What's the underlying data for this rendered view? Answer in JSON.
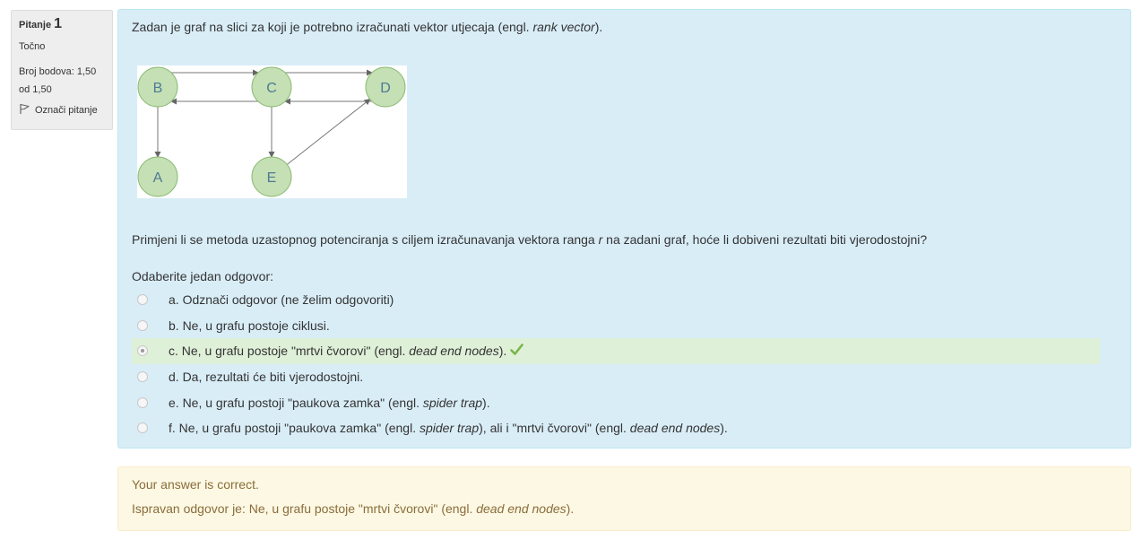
{
  "info": {
    "question_word": "Pitanje",
    "question_number": "1",
    "state": "Točno",
    "grade_line1": "Broj bodova: 1,50",
    "grade_line2": "od 1,50",
    "flag_label": "Označi pitanje",
    "flag_icon": "flag-icon"
  },
  "question": {
    "text_before": "Zadan je graf na slici za koji je potrebno izračunati vektor utjecaja (engl. ",
    "text_italic": "rank vector",
    "text_after": ").",
    "graph": {
      "nodes": [
        "B",
        "C",
        "D",
        "A",
        "E"
      ],
      "edges": [
        [
          "B",
          "C"
        ],
        [
          "C",
          "D"
        ],
        [
          "D",
          "C"
        ],
        [
          "C",
          "B"
        ],
        [
          "B",
          "A"
        ],
        [
          "C",
          "E"
        ],
        [
          "E",
          "D"
        ]
      ],
      "node_fill": "#c5e0b4",
      "node_stroke": "#8bbb74",
      "label_color": "#4d7a96"
    },
    "text2_before": "Primjeni li se metoda uzastopnog potenciranja s ciljem izračunavanja vektora ranga ",
    "text2_italic": "r",
    "text2_after": " na zadani graf, hoće li dobiveni rezultati biti vjerodostojni?",
    "prompt": "Odaberite jedan odgovor:"
  },
  "options": [
    {
      "label": "a. Odznači odgovor (ne želim odgovoriti)"
    },
    {
      "label": "b. Ne, u grafu postoje ciklusi."
    },
    {
      "prefix": "c. Ne, u grafu postoje \"mrtvi čvorovi\" (engl. ",
      "italic": "dead end nodes",
      "suffix": ").",
      "selected": true,
      "correct": true
    },
    {
      "label": "d. Da, rezultati će biti vjerodostojni."
    },
    {
      "prefix": "e. Ne, u grafu postoji \"paukova zamka\" (engl. ",
      "italic": "spider trap",
      "suffix": ")."
    },
    {
      "prefix": "f. Ne, u grafu postoji \"paukova zamka\" (engl. ",
      "italic": "spider trap",
      "middle": "), ali i \"mrtvi čvorovi\" (engl. ",
      "italic2": "dead end nodes",
      "suffix": ")."
    }
  ],
  "feedback": {
    "general": "Your answer is correct.",
    "right_prefix": "Ispravan odgovor je: Ne, u grafu postoje \"mrtvi čvorovi\" (engl. ",
    "right_italic": "dead end nodes",
    "right_suffix": ").",
    "check_icon": "checkmark-icon",
    "check_color": "#7ab648"
  }
}
